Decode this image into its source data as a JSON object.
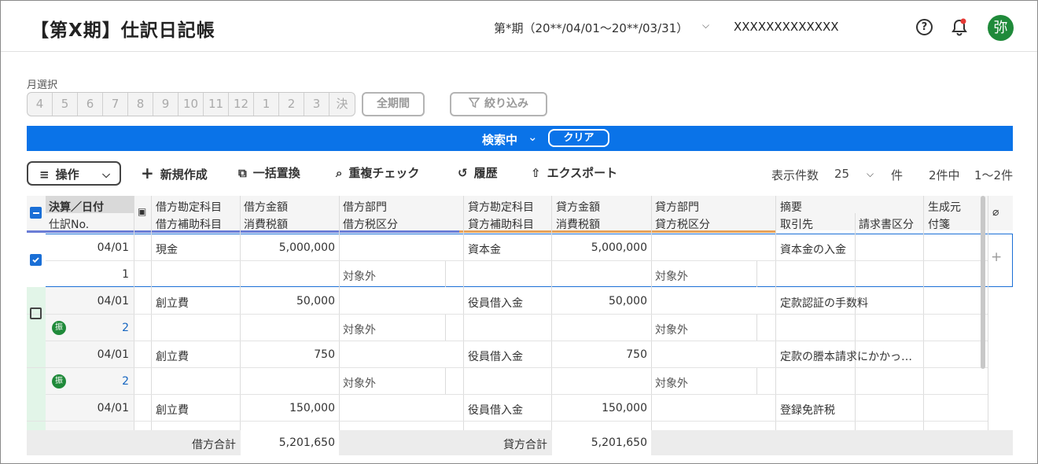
{
  "header": {
    "title": "【第X期】仕訳日記帳",
    "period": "第*期（20**/04/01～20**/03/31）",
    "company": "XXXXXXXXXXXXX",
    "avatar": "弥",
    "help": "?"
  },
  "filters": {
    "month_label": "月選択",
    "months": [
      "4",
      "5",
      "6",
      "7",
      "8",
      "9",
      "10",
      "11",
      "12",
      "1",
      "2",
      "3",
      "決"
    ],
    "all_period": "全期間",
    "narrow": "絞り込み"
  },
  "searchbar": {
    "status": "検索中",
    "clear": "クリア"
  },
  "toolbar": {
    "ops": "操作",
    "new": "新規作成",
    "bulk": "一括置換",
    "dup": "重複チェック",
    "history": "履歴",
    "export": "エクスポート"
  },
  "paging": {
    "label": "表示件数",
    "per_page": "25",
    "unit": "件",
    "total": "2件中",
    "range": "1～2件"
  },
  "columns": {
    "date": "決算／日付",
    "no": "仕訳No.",
    "dr_acct": "借方勘定科目",
    "dr_sub": "借方補助科目",
    "dr_amt": "借方金額",
    "dr_tax": "消費税額",
    "dr_dept": "借方部門",
    "dr_taxcat": "借方税区分",
    "cr_acct": "貸方勘定科目",
    "cr_sub": "貸方補助科目",
    "cr_amt": "貸方金額",
    "cr_tax": "消費税額",
    "cr_dept": "貸方部門",
    "cr_taxcat": "貸方税区分",
    "memo": "摘要",
    "partner": "取引先",
    "invoice": "請求書区分",
    "source": "生成元",
    "tag": "付箋"
  },
  "rows": [
    {
      "date": "04/01",
      "no": "1",
      "dr_acct": "現金",
      "dr_amt": "5,000,000",
      "dr_taxcat": "対象外",
      "cr_acct": "資本金",
      "cr_amt": "5,000,000",
      "cr_taxcat": "対象外",
      "memo": "資本金の入金"
    },
    {
      "date": "04/01",
      "no": "2",
      "badge": "振",
      "dr_acct": "創立費",
      "dr_amt": "50,000",
      "dr_taxcat": "対象外",
      "cr_acct": "役員借入金",
      "cr_amt": "50,000",
      "cr_taxcat": "対象外",
      "memo": "定款認証の手数料"
    },
    {
      "date": "04/01",
      "no": "2",
      "badge": "振",
      "dr_acct": "創立費",
      "dr_amt": "750",
      "dr_taxcat": "対象外",
      "cr_acct": "役員借入金",
      "cr_amt": "750",
      "cr_taxcat": "対象外",
      "memo": "定款の謄本請求にかかっ…"
    },
    {
      "date": "04/01",
      "dr_acct": "創立費",
      "dr_amt": "150,000",
      "cr_acct": "役員借入金",
      "cr_amt": "150,000",
      "memo": "登録免許税"
    }
  ],
  "totals": {
    "dr_label": "借方合計",
    "dr_value": "5,201,650",
    "cr_label": "貸方合計",
    "cr_value": "5,201,650"
  },
  "colors": {
    "accent": "#0a73e8",
    "checked": "#1a6fd6",
    "avatar": "#1f8a3a",
    "debit_line": "#6a7dd6",
    "credit_line": "#e8a25a"
  }
}
